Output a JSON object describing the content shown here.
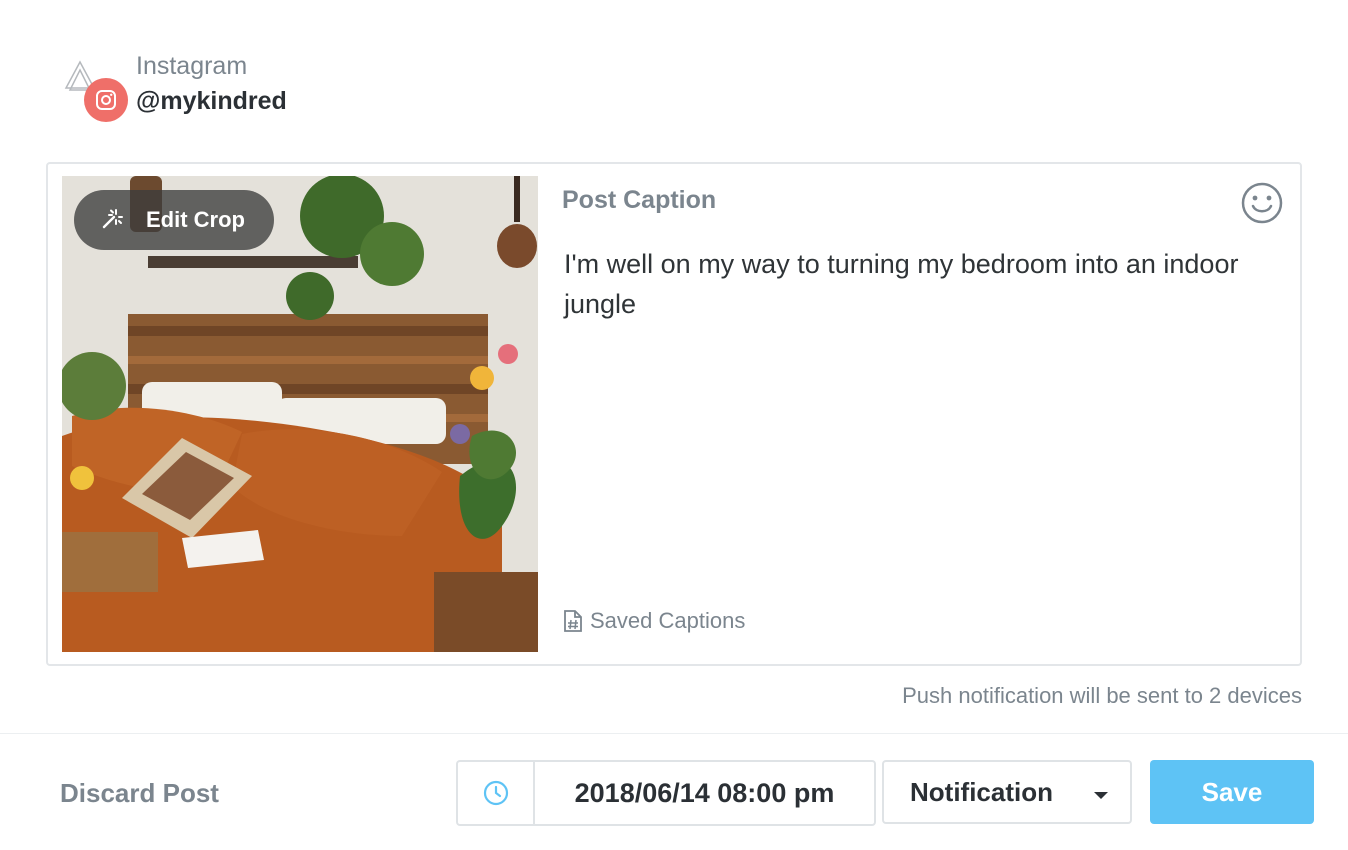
{
  "account": {
    "platform": "Instagram",
    "handle": "@mykindred",
    "badge_icon": "instagram-icon",
    "badge_color": "#ef6f69"
  },
  "post": {
    "image_alt": "Bedroom with wooden headboard, orange bedding and plants",
    "edit_crop_label": "Edit Crop",
    "caption_title": "Post Caption",
    "caption_text": "I'm well on my way to turning my bedroom into an indoor jungle",
    "saved_captions_label": "Saved Captions"
  },
  "push_note": "Push notification will be sent to 2 devices",
  "footer": {
    "discard_label": "Discard Post",
    "datetime_value": "2018/06/14 08:00 pm",
    "type_value": "Notification",
    "save_label": "Save"
  },
  "colors": {
    "accent": "#5ec3f5",
    "muted_text": "#7b858e",
    "border": "#dfe3e6"
  }
}
